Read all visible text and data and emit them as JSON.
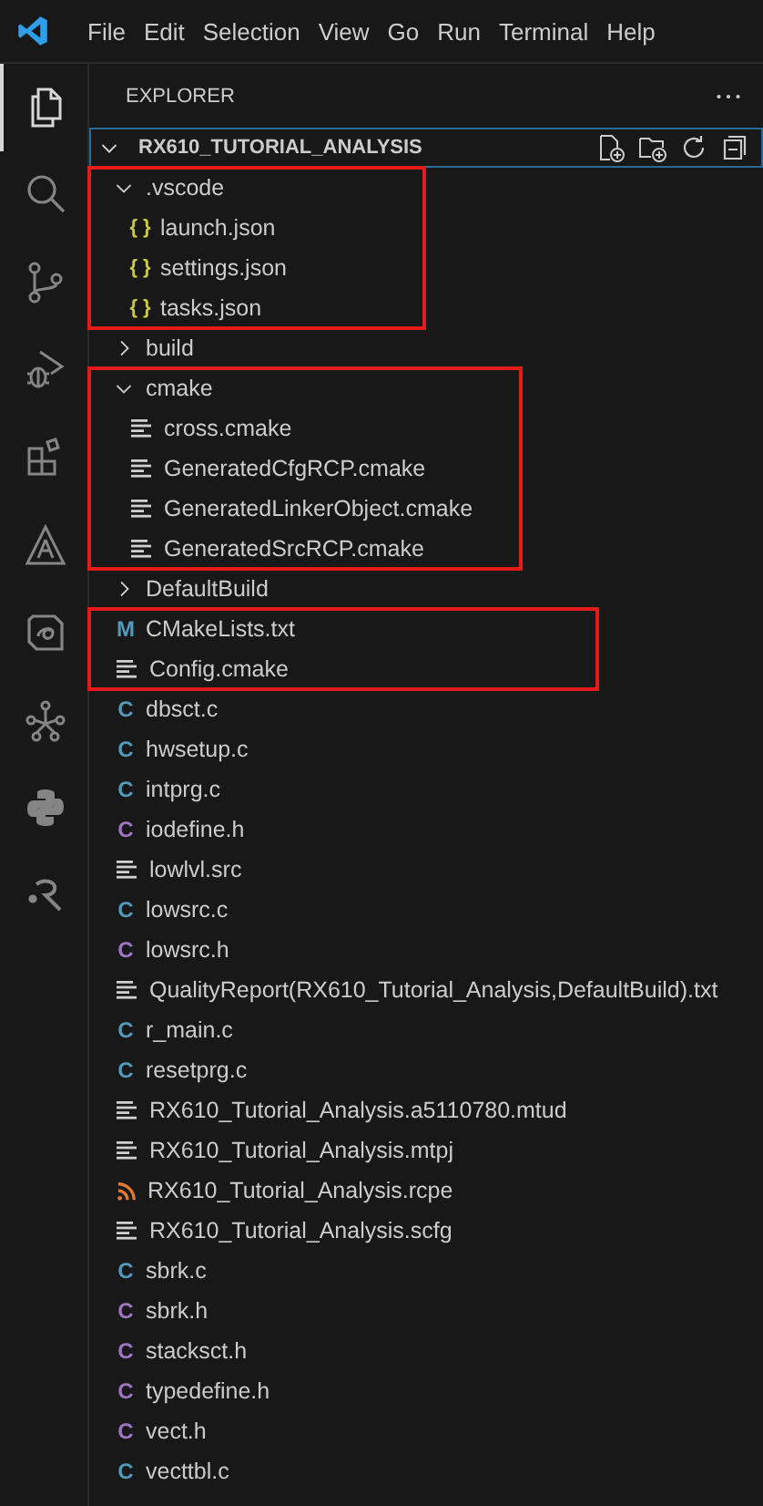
{
  "menu": [
    "File",
    "Edit",
    "Selection",
    "View",
    "Go",
    "Run",
    "Terminal",
    "Help"
  ],
  "activity_bar": [
    {
      "kind": "explorer",
      "selected": true
    },
    {
      "kind": "search",
      "selected": false
    },
    {
      "kind": "source_control",
      "selected": false
    },
    {
      "kind": "run_debug",
      "selected": false
    },
    {
      "kind": "extensions",
      "selected": false
    },
    {
      "kind": "triangle",
      "selected": false
    },
    {
      "kind": "swirl",
      "selected": false
    },
    {
      "kind": "network",
      "selected": false
    },
    {
      "kind": "snake",
      "selected": false
    },
    {
      "kind": "curl",
      "selected": false
    }
  ],
  "explorer": {
    "title": "EXPLORER",
    "root": {
      "label": "RX610_TUTORIAL_ANALYSIS",
      "expanded": true,
      "groups": [
        {
          "highlighted": true,
          "items": [
            {
              "label": ".vscode",
              "kind": "folder",
              "expanded": true,
              "children": [
                {
                  "label": "launch.json",
                  "kind": "json",
                  "icon": "{ }"
                },
                {
                  "label": "settings.json",
                  "kind": "json",
                  "icon": "{ }"
                },
                {
                  "label": "tasks.json",
                  "kind": "json",
                  "icon": "{ }"
                }
              ]
            }
          ]
        },
        {
          "highlighted": false,
          "items": [
            {
              "label": "build",
              "kind": "folder",
              "expanded": false
            }
          ]
        },
        {
          "highlighted": true,
          "items": [
            {
              "label": "cmake",
              "kind": "folder",
              "expanded": true,
              "children": [
                {
                  "label": "cross.cmake",
                  "kind": "lines"
                },
                {
                  "label": "GeneratedCfgRCP.cmake",
                  "kind": "lines"
                },
                {
                  "label": "GeneratedLinkerObject.cmake",
                  "kind": "lines"
                },
                {
                  "label": "GeneratedSrcRCP.cmake",
                  "kind": "lines"
                }
              ]
            }
          ]
        },
        {
          "highlighted": false,
          "items": [
            {
              "label": "DefaultBuild",
              "kind": "folder",
              "expanded": false
            }
          ]
        },
        {
          "highlighted": true,
          "items": [
            {
              "label": "CMakeLists.txt",
              "kind": "cmakelists",
              "icon": "M"
            },
            {
              "label": "Config.cmake",
              "kind": "lines"
            }
          ]
        },
        {
          "highlighted": false,
          "items": [
            {
              "label": "dbsct.c",
              "kind": "c",
              "icon": "C"
            },
            {
              "label": "hwsetup.c",
              "kind": "c",
              "icon": "C"
            },
            {
              "label": "intprg.c",
              "kind": "c",
              "icon": "C"
            },
            {
              "label": "iodefine.h",
              "kind": "h",
              "icon": "C"
            },
            {
              "label": "lowlvl.src",
              "kind": "lines"
            },
            {
              "label": "lowsrc.c",
              "kind": "c",
              "icon": "C"
            },
            {
              "label": "lowsrc.h",
              "kind": "h",
              "icon": "C"
            },
            {
              "label": "QualityReport(RX610_Tutorial_Analysis,DefaultBuild).txt",
              "kind": "lines"
            },
            {
              "label": "r_main.c",
              "kind": "c",
              "icon": "C"
            },
            {
              "label": "resetprg.c",
              "kind": "c",
              "icon": "C"
            },
            {
              "label": "RX610_Tutorial_Analysis.a5110780.mtud",
              "kind": "lines"
            },
            {
              "label": "RX610_Tutorial_Analysis.mtpj",
              "kind": "lines"
            },
            {
              "label": "RX610_Tutorial_Analysis.rcpe",
              "kind": "rss"
            },
            {
              "label": "RX610_Tutorial_Analysis.scfg",
              "kind": "lines"
            },
            {
              "label": "sbrk.c",
              "kind": "c",
              "icon": "C"
            },
            {
              "label": "sbrk.h",
              "kind": "h",
              "icon": "C"
            },
            {
              "label": "stacksct.h",
              "kind": "h",
              "icon": "C"
            },
            {
              "label": "typedefine.h",
              "kind": "h",
              "icon": "C"
            },
            {
              "label": "vect.h",
              "kind": "h",
              "icon": "C"
            },
            {
              "label": "vecttbl.c",
              "kind": "c",
              "icon": "C"
            }
          ]
        }
      ]
    }
  }
}
